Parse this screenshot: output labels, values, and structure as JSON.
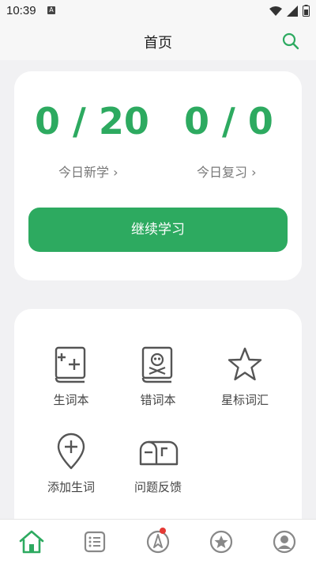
{
  "status_bar": {
    "time": "10:39",
    "notification_letter": "A"
  },
  "header": {
    "title": "首页"
  },
  "study": {
    "new": {
      "value": "0 / 20",
      "label": "今日新学 ›"
    },
    "review": {
      "value": "0 / 0",
      "label": "今日复习 ›"
    },
    "continue_label": "继续学习"
  },
  "features": [
    {
      "label": "生词本",
      "icon": "new-words-book-icon"
    },
    {
      "label": "错词本",
      "icon": "wrong-words-book-icon"
    },
    {
      "label": "星标词汇",
      "icon": "star-icon"
    },
    {
      "label": "添加生词",
      "icon": "add-location-pin-icon"
    },
    {
      "label": "问题反馈",
      "icon": "mailbox-icon"
    }
  ],
  "tabs": [
    {
      "name": "home",
      "icon": "home-icon",
      "active": true
    },
    {
      "name": "list",
      "icon": "list-icon",
      "active": false
    },
    {
      "name": "explore",
      "icon": "compass-icon",
      "active": false,
      "badge": true
    },
    {
      "name": "starred",
      "icon": "star-circle-icon",
      "active": false
    },
    {
      "name": "profile",
      "icon": "user-icon",
      "active": false
    }
  ],
  "colors": {
    "accent": "#2daa60",
    "badge": "#e53935",
    "background": "#f1f1f3"
  }
}
